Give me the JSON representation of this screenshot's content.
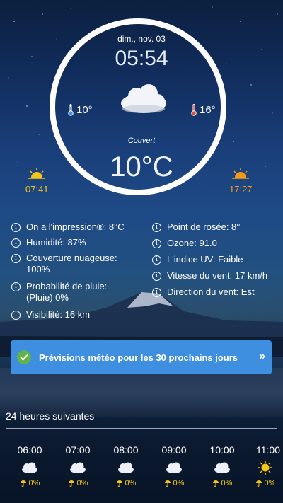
{
  "header": {
    "date": "dim., nov. 03",
    "time": "05:54",
    "temp_min": "10°",
    "temp_max": "16°",
    "condition": "Couvert",
    "temp_current": "10°C",
    "sunrise": "07:41",
    "sunset": "17:27"
  },
  "details_left": [
    "On a l'impression®: 8°C",
    "Humidité: 87%",
    "Couverture nuageuse: 100%",
    "Probabilité de pluie: (Pluie) 0%",
    "Visibilité: 16 km"
  ],
  "details_right": [
    "Point de rosée: 8°",
    "Ozone: 91.0",
    "L'indice UV: Faible",
    "Vitesse du vent: 17 km/h",
    "Direction du vent: Est"
  ],
  "banner": {
    "label": "Prévisions météo pour les 30 prochains jours",
    "chevron": "»"
  },
  "hourly": {
    "title": "24 heures suivantes",
    "items": [
      {
        "time": "06:00",
        "icon": "cloud-icon",
        "precip": "0%"
      },
      {
        "time": "07:00",
        "icon": "cloud-icon",
        "precip": "0%"
      },
      {
        "time": "08:00",
        "icon": "cloud-icon",
        "precip": "0%"
      },
      {
        "time": "09:00",
        "icon": "cloud-icon",
        "precip": "0%"
      },
      {
        "time": "10:00",
        "icon": "cloud-icon",
        "precip": "0%"
      },
      {
        "time": "11:00",
        "icon": "sun-icon",
        "precip": "0%"
      }
    ]
  },
  "colors": {
    "accent_sunrise": "#f5c518",
    "accent_sunset": "#f39a1e",
    "banner": "#3e8fe0",
    "check": "#62b34a"
  }
}
